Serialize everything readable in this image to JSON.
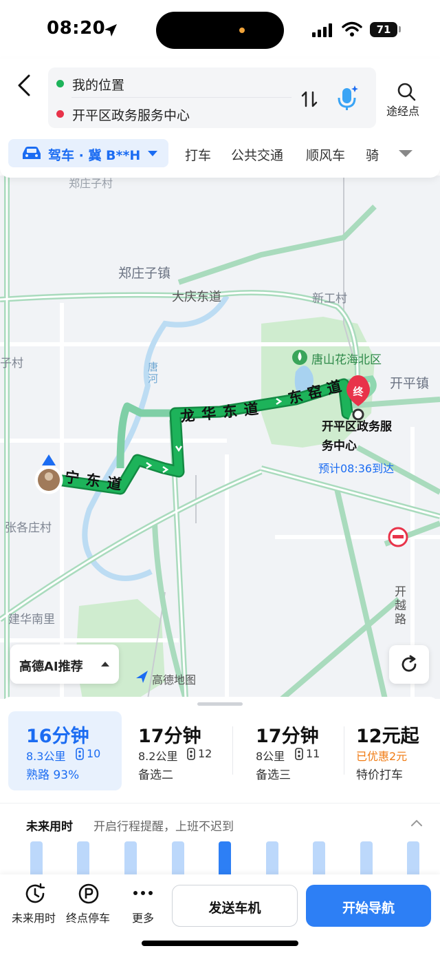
{
  "status_bar": {
    "time": "08:20",
    "battery": "71"
  },
  "search": {
    "origin": "我的位置",
    "destination": "开平区政务服务中心",
    "via_label": "途经点"
  },
  "modes": {
    "active": "驾车 · 冀 B**H",
    "tabs": [
      "打车",
      "公共交通",
      "顺风车",
      "骑"
    ]
  },
  "map": {
    "labels": {
      "zhengzhuangzi_village": "郑庄子村",
      "zhengzhuangzi_town": "郑庄子镇",
      "daqing_road": "大庆东道",
      "xingong_village": "新工村",
      "park": "唐山花海北区",
      "kaiping_town": "开平镇",
      "zi_village": "子村",
      "river": "唐河",
      "longhua_road": "龙华东道",
      "dongyao_road": "东窑道",
      "ning_road": "宁东道",
      "zhangge_village": "张各庄村",
      "jianhua": "建华南里",
      "kaiyue_road": "开越路",
      "destination_line1": "开平区政务服",
      "destination_line2": "务中心",
      "eta": "预计08:36到达",
      "end_marker": "终",
      "amap_logo": "高德地图"
    },
    "ai_button": "高德AI推荐"
  },
  "routes": [
    {
      "time": "16分钟",
      "distance": "8.3公里",
      "lights": "10",
      "sub": "熟路 93%",
      "selected": true
    },
    {
      "time": "17分钟",
      "distance": "8.2公里",
      "lights": "12",
      "sub": "备选二",
      "selected": false
    },
    {
      "time": "17分钟",
      "distance": "8公里",
      "lights": "11",
      "sub": "备选三",
      "selected": false
    },
    {
      "time": "12元起",
      "discount": "已优惠2元",
      "sub": "特价打车",
      "selected": false
    }
  ],
  "future": {
    "label": "未来用时",
    "hint": "开启行程提醒，上班不迟到",
    "bars_active_index": 4
  },
  "bottom_bar": {
    "future_time": "未来用时",
    "parking": "终点停车",
    "more": "更多",
    "send_car": "发送车机",
    "start_nav": "开始导航"
  },
  "colors": {
    "accent_blue": "#2d7ff5",
    "route_green": "#1db35a",
    "route_alt": "#8fd7b0",
    "destination_red": "#e8334a",
    "discount_orange": "#f07b13"
  }
}
